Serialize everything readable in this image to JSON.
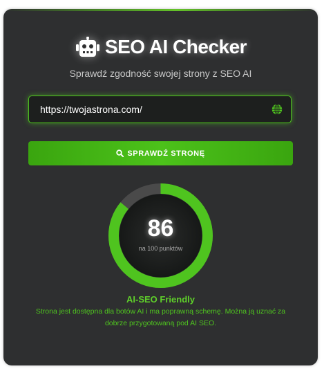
{
  "app": {
    "title": "SEO AI Checker",
    "subtitle": "Sprawdź zgodność swojej strony z SEO AI",
    "logo_icon": "robot-icon"
  },
  "form": {
    "url_value": "https://twojastrona.com/",
    "url_icon": "globe-icon",
    "submit_label": "SPRAWDŹ STRONĘ",
    "submit_icon": "search-icon"
  },
  "result": {
    "score": "86",
    "score_fraction": 0.86,
    "score_caption": "na 100 punktów",
    "status_title": "AI-SEO Friendly",
    "status_description": "Strona jest dostępna dla botów AI i ma poprawną schemę. Można ją uznać za dobrze przygotowaną pod AI SEO."
  },
  "colors": {
    "accent": "#4fc41f",
    "card_background": "#2e2f30",
    "gauge_track": "#4a4a4a",
    "gauge_center": "#1f2120"
  }
}
